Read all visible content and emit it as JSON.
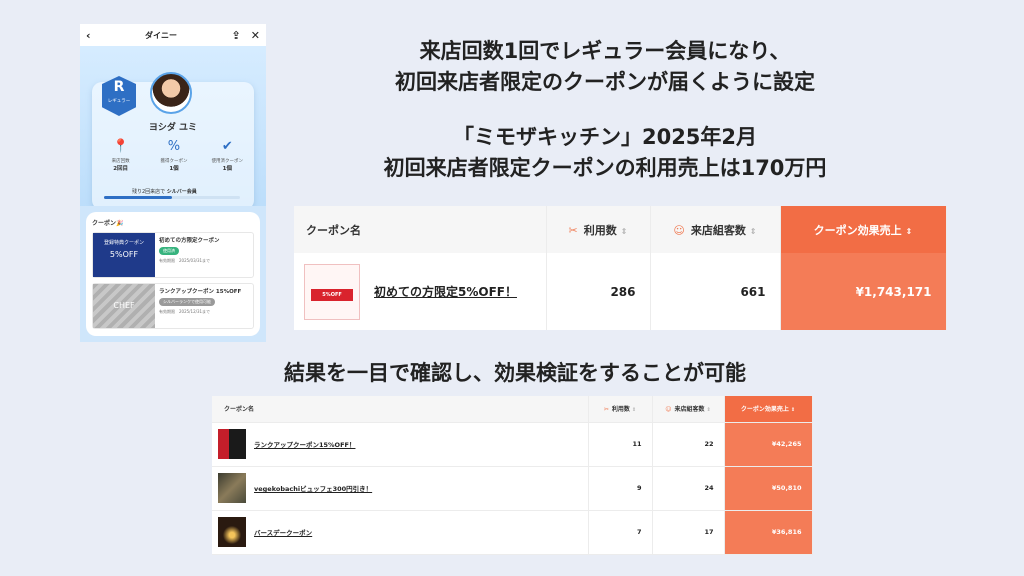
{
  "phone": {
    "back_glyph": "‹",
    "title": "ダイニー",
    "share_glyph": "⇪",
    "close_glyph": "✕",
    "rank_letter": "R",
    "rank_name": "レギュラー",
    "user_name": "ヨシダ ユミ",
    "stats": [
      {
        "label": "来店回数",
        "value": "2回目",
        "icon": "location-pin-icon",
        "glyph": "📍"
      },
      {
        "label": "獲得クーポン",
        "value": "1個",
        "icon": "coupon-icon",
        "glyph": "%"
      },
      {
        "label": "使用済クーポン",
        "value": "1個",
        "icon": "check-icon",
        "glyph": "✔"
      }
    ],
    "progress_text": "残り2回来店で",
    "progress_target": "シルバー会員",
    "progress_fraction": 0.5,
    "coupon_section_title": "クーポン",
    "coupon_party_glyph": "🎉",
    "coupons": [
      {
        "image_text": "登録特典クーポン",
        "image_off": "5%OFF",
        "name": "初めての方限定クーポン",
        "status": "使用済",
        "expiry": "有効期限　2025/03/31まで"
      },
      {
        "image_text": "CHEF",
        "name": "ランクアップクーポン 15%OFF",
        "status": "シルバーランクで使用可能",
        "expiry": "有効期限　2025/12/31まで"
      }
    ]
  },
  "headline1": [
    "来店回数1回でレギュラー会員になり、",
    "初回来店者限定のクーポンが届くように設定"
  ],
  "headline2": [
    "「ミモザキッチン」2025年2月",
    "初回来店者限定クーポンの利用売上は170万円"
  ],
  "headline3": "結果を一目で確認し、効果検証をすることが可能",
  "big_table": {
    "headers": {
      "coupon": "クーポン名",
      "uses": "利用数",
      "groups": "来店組客数",
      "sales": "クーポン効果売上"
    },
    "sort_glyph": "⇕",
    "row": {
      "thumb_text": "5%OFF",
      "name": "初めての方限定5%OFF！",
      "uses": "286",
      "groups": "661",
      "sales": "¥1,743,171"
    }
  },
  "small_table": {
    "headers": {
      "coupon": "クーポン名",
      "uses": "利用数",
      "groups": "来店組客数",
      "sales": "クーポン効果売上"
    },
    "rows": [
      {
        "name": "ランクアップクーポン15%OFF！",
        "uses": "11",
        "groups": "22",
        "sales": "¥42,265"
      },
      {
        "name": "vegekobachiビュッフェ300円引き！",
        "uses": "9",
        "groups": "24",
        "sales": "¥50,810"
      },
      {
        "name": "バースデークーポン",
        "uses": "7",
        "groups": "17",
        "sales": "¥36,816"
      }
    ]
  },
  "colors": {
    "accent": "#f26d45",
    "brand_blue": "#2e6fc4",
    "background": "#e9edf6"
  }
}
